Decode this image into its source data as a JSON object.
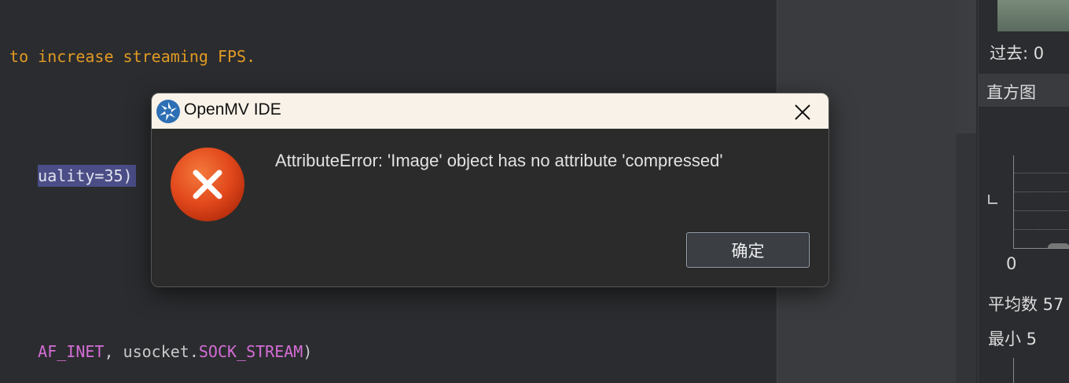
{
  "editor": {
    "line1": " to increase streaming FPS.",
    "line2": "uality=35)",
    "line3a": "AF_INET",
    "line3b": ", usocket.",
    "line3c": "SOCK_STREAM",
    "line3d": ")"
  },
  "right_panel": {
    "past_label": "过去:  0",
    "histogram_label": "直方图",
    "axis_zero": "0",
    "mean_label": "平均数  57",
    "min_label": "最小    5"
  },
  "dialog": {
    "title": "OpenMV IDE",
    "message": "AttributeError: 'Image' object has no attribute 'compressed'",
    "ok_label": "确定",
    "icons": {
      "app": "openmv-app-icon",
      "error": "error-icon",
      "close": "close-icon"
    }
  },
  "colors": {
    "comment": "#e09a24",
    "selection": "#4a4d86",
    "keyword": "#d46dd6",
    "error_red": "#e0461a",
    "titlebar": "#f8f2e8"
  }
}
